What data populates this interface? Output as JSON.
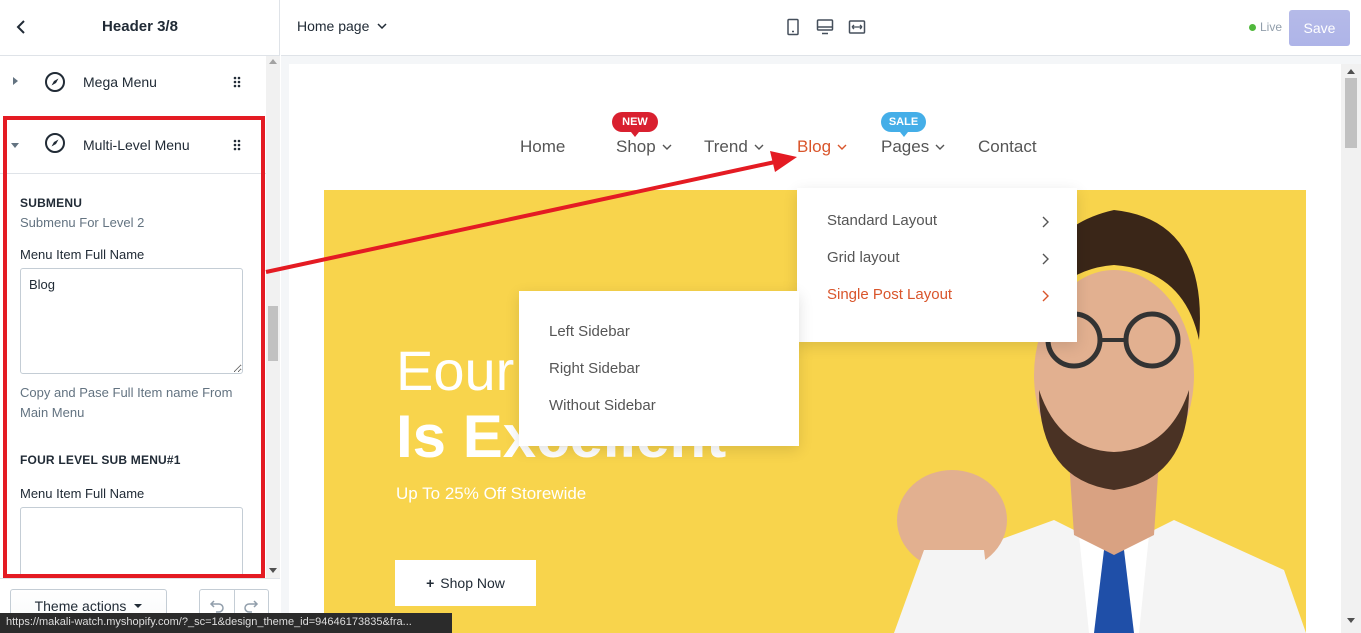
{
  "left_panel": {
    "title": "Header 3/8",
    "items": [
      {
        "label": "Mega Menu"
      },
      {
        "label": "Multi-Level Menu"
      }
    ],
    "submenu": {
      "section_title": "SUBMENU",
      "section_sub": "Submenu For Level 2",
      "field_label": "Menu Item Full Name",
      "field_value": "Blog",
      "help_text": "Copy and Pase Full Item name From Main Menu",
      "section2_title": "FOUR LEVEL SUB MENU#1",
      "field2_label": "Menu Item Full Name",
      "field2_value": ""
    },
    "footer": {
      "theme_actions": "Theme actions"
    }
  },
  "topbar": {
    "page": "Home page",
    "live": "Live",
    "save": "Save",
    "accent": "#aeb4e8"
  },
  "preview": {
    "nav": [
      {
        "label": "Home"
      },
      {
        "label": "Shop",
        "badge": "NEW"
      },
      {
        "label": "Trend"
      },
      {
        "label": "Blog"
      },
      {
        "label": "Pages",
        "badge": "SALE"
      },
      {
        "label": "Contact"
      }
    ],
    "blog_dropdown": [
      {
        "label": "Standard Layout"
      },
      {
        "label": "Grid layout"
      },
      {
        "label": "Single Post Layout"
      }
    ],
    "sub_dropdown": [
      {
        "label": "Left Sidebar"
      },
      {
        "label": "Right Sidebar"
      },
      {
        "label": "Without Sidebar"
      }
    ],
    "hero": {
      "line1": "Eour",
      "line2": "Is Excellent",
      "sub": "Up To 25% Off Storewide",
      "cta": "Shop Now"
    },
    "colors": {
      "hero_bg": "#f8d44c",
      "active": "#d9552b",
      "badge_new": "#d9202f",
      "badge_sale": "#44aee8",
      "highlight": "#e41b23"
    }
  },
  "status_url": "https://makali-watch.myshopify.com/?_sc=1&design_theme_id=94646173835&fra..."
}
